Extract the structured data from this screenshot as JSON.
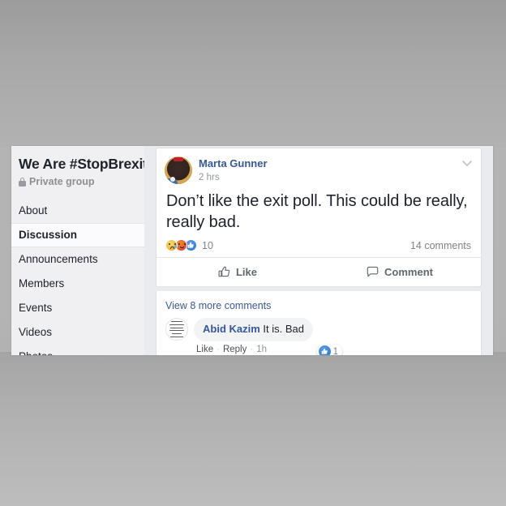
{
  "sidebar": {
    "group_title": "We Are #StopBrexit",
    "privacy_label": "Private group",
    "lock_icon": "lock-icon",
    "items": [
      {
        "label": "About",
        "active": false
      },
      {
        "label": "Discussion",
        "active": true
      },
      {
        "label": "Announcements",
        "active": false
      },
      {
        "label": "Members",
        "active": false
      },
      {
        "label": "Events",
        "active": false
      },
      {
        "label": "Videos",
        "active": false
      },
      {
        "label": "Photos",
        "active": false
      }
    ]
  },
  "post": {
    "author": "Marta Gunner",
    "timestamp": "2 hrs",
    "menu_icon": "chevron-down-icon",
    "body": "Don’t like the exit poll. This could be really, really bad.",
    "reactions": {
      "icons": [
        "sad-reaction-icon",
        "angry-reaction-icon",
        "like-reaction-icon"
      ],
      "count": "10"
    },
    "comment_count": "14 comments",
    "actions": [
      {
        "label": "Like",
        "icon": "thumbs-up-icon"
      },
      {
        "label": "Comment",
        "icon": "speech-bubble-icon"
      }
    ]
  },
  "comments": {
    "view_more": "View 8 more comments",
    "items": [
      {
        "author": "Abid Kazim",
        "text": " It is. Bad",
        "avatar_icon": "document-avatar-icon",
        "meta": {
          "like": "Like",
          "reply": "Reply",
          "time": "1h",
          "separator": "·"
        },
        "like_badge": {
          "icon": "like-reaction-icon",
          "count": "1"
        }
      }
    ]
  },
  "colors": {
    "link_blue": "#365899",
    "muted_gray": "#90949c",
    "backdrop": "#b0b0b0",
    "sidebar_bg": "#f0f0f3"
  }
}
